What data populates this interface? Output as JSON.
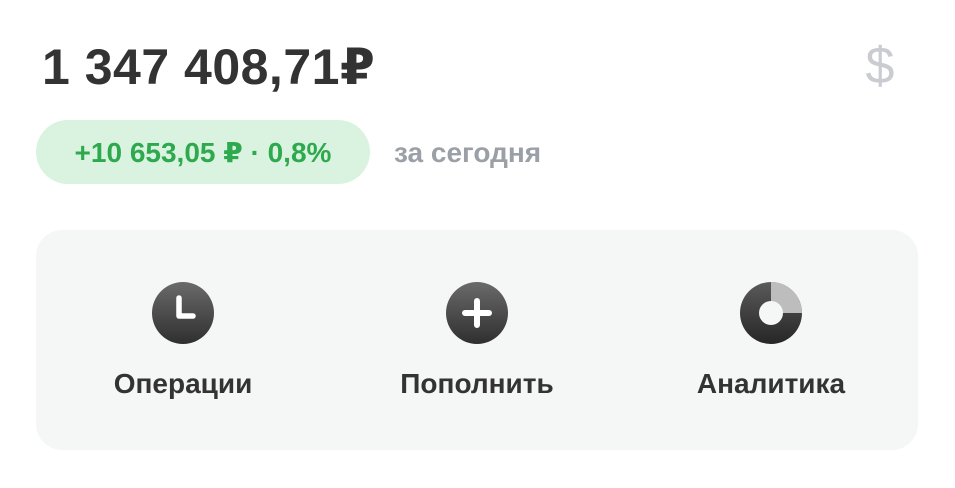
{
  "portfolio": {
    "balance": "1 347 408,71₽",
    "currency_icon": "dollar-icon",
    "currency_symbol": "$"
  },
  "daily_change": {
    "text": "+10 653,05 ₽ · 0,8%",
    "period": "за сегодня",
    "color": "#2fa94e",
    "background": "#daf3e1"
  },
  "actions": [
    {
      "label": "Операции",
      "icon": "clock-icon"
    },
    {
      "label": "Пополнить",
      "icon": "plus-circle-icon"
    },
    {
      "label": "Аналитика",
      "icon": "donut-chart-icon"
    }
  ],
  "colors": {
    "text_primary": "#333333",
    "text_secondary": "#9aa0a6",
    "card_background": "#f5f6f6",
    "icon_dark": "#3a3a3a"
  }
}
